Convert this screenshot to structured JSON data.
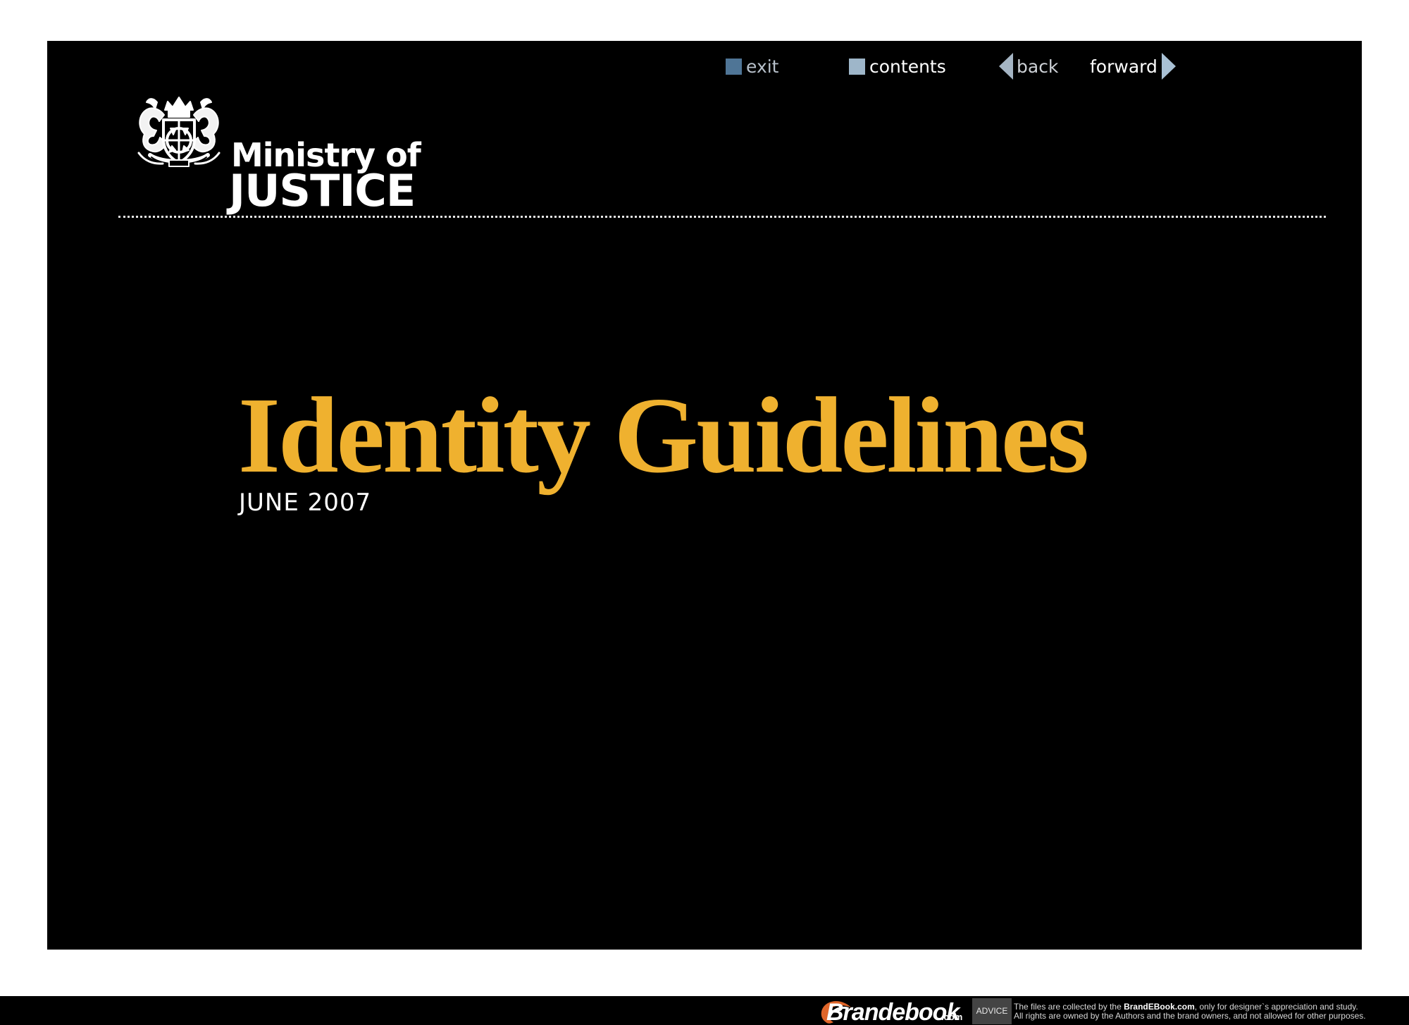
{
  "navigation": {
    "exit_label": "exit",
    "contents_label": "contents",
    "back_label": "back",
    "forward_label": "forward",
    "icons": {
      "exit": "square-icon",
      "contents": "square-icon",
      "back": "back-arrow-icon",
      "forward": "forward-arrow-icon"
    },
    "colors": {
      "exit_icon": "#4f7596",
      "contents_icon": "#9eb6c9",
      "back_arrow": "#a5b5c4",
      "forward_arrow": "#a9c1d5"
    }
  },
  "brand": {
    "name_line_1": "Ministry of",
    "name_line_2": "JUSTICE",
    "crest_icon": "royal-coat-of-arms-icon"
  },
  "cover": {
    "title": "Identity Guidelines",
    "date": "JUNE 2007",
    "title_color": "#efb12f",
    "background_color": "#000000"
  },
  "footer": {
    "brandebook_name": "Brandebook",
    "brandebook_domain": ".com",
    "advice_label": "ADVICE",
    "legal_prefix": "The files are collected by the ",
    "legal_site": "BrandEBook.com",
    "legal_suffix": ", only for designer`s appreciation and study.",
    "legal_line_2": "All rights are owned by the Authors and the brand owners, and not allowed for other purposes."
  }
}
